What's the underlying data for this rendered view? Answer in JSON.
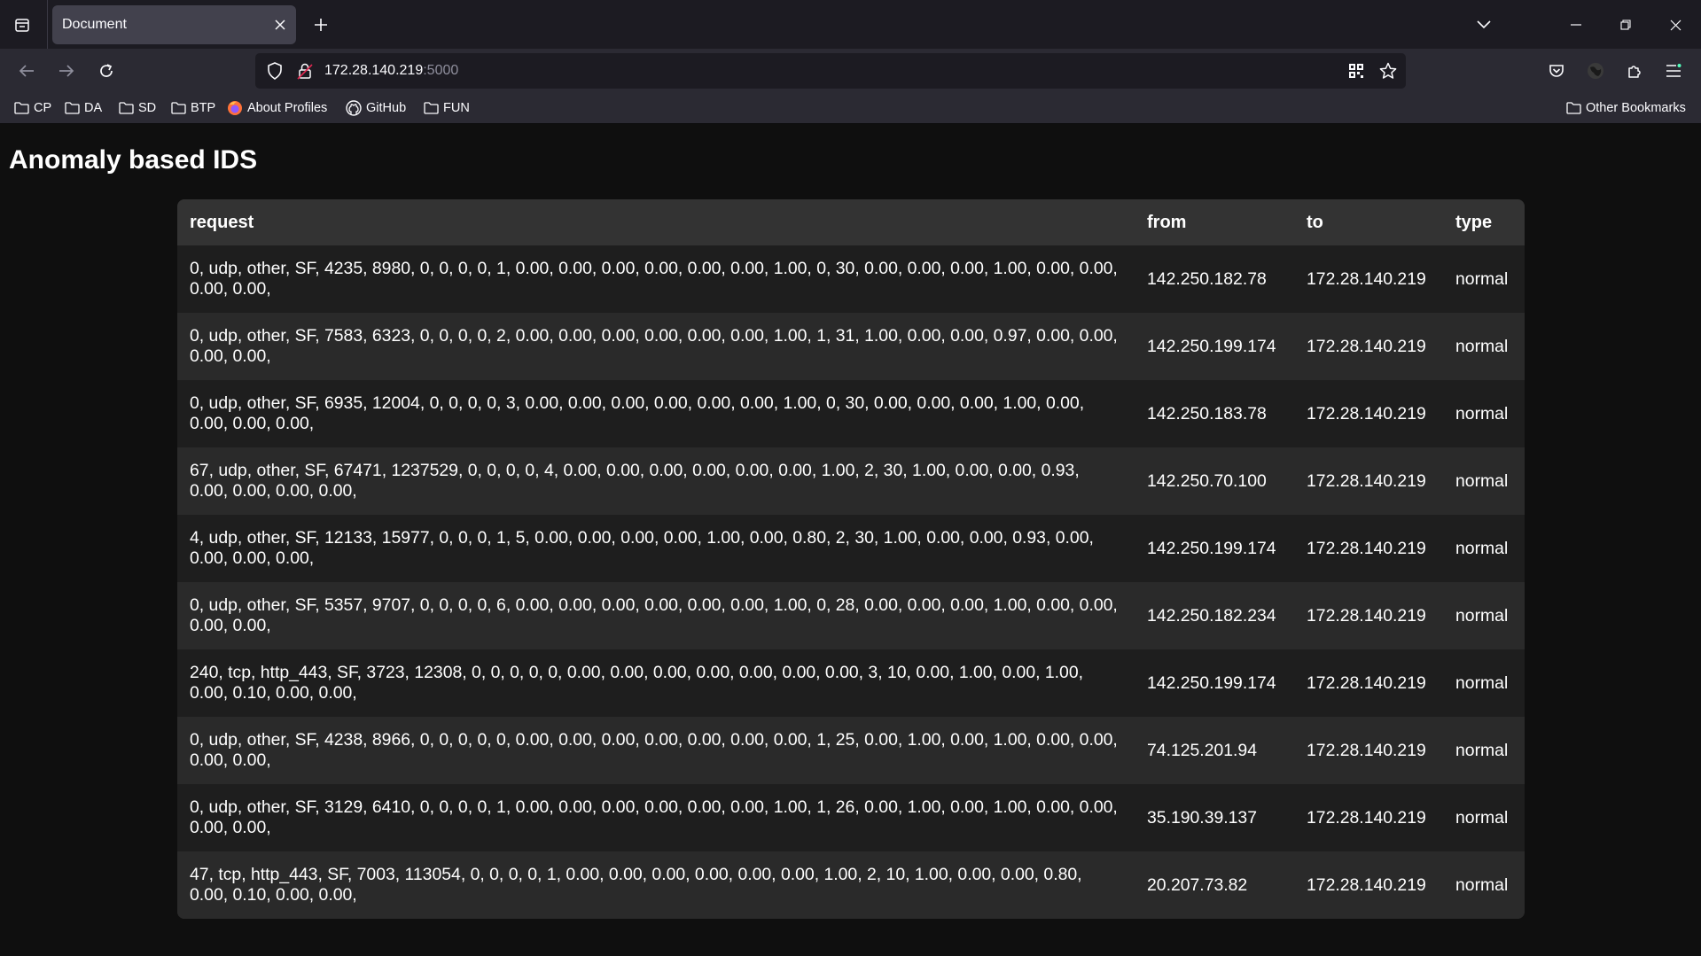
{
  "browser": {
    "tab_title": "Document",
    "url_host": "172.28.140.219",
    "url_port": ":5000",
    "bookmarks": [
      "CP",
      "DA",
      "SD",
      "BTP",
      "About Profiles",
      "GitHub",
      "FUN"
    ],
    "other_bookmarks": "Other Bookmarks"
  },
  "page": {
    "heading": "Anomaly based IDS",
    "columns": [
      "request",
      "from",
      "to",
      "type"
    ],
    "rows": [
      {
        "request": "0, udp, other, SF, 4235, 8980, 0, 0, 0, 0, 1, 0.00, 0.00, 0.00, 0.00, 0.00, 0.00, 1.00, 0, 30, 0.00, 0.00, 0.00, 1.00, 0.00, 0.00, 0.00, 0.00,",
        "from": "142.250.182.78",
        "to": "172.28.140.219",
        "type": "normal"
      },
      {
        "request": "0, udp, other, SF, 7583, 6323, 0, 0, 0, 0, 2, 0.00, 0.00, 0.00, 0.00, 0.00, 0.00, 1.00, 1, 31, 1.00, 0.00, 0.00, 0.97, 0.00, 0.00, 0.00, 0.00,",
        "from": "142.250.199.174",
        "to": "172.28.140.219",
        "type": "normal"
      },
      {
        "request": "0, udp, other, SF, 6935, 12004, 0, 0, 0, 0, 3, 0.00, 0.00, 0.00, 0.00, 0.00, 0.00, 1.00, 0, 30, 0.00, 0.00, 0.00, 1.00, 0.00, 0.00, 0.00, 0.00,",
        "from": "142.250.183.78",
        "to": "172.28.140.219",
        "type": "normal"
      },
      {
        "request": "67, udp, other, SF, 67471, 1237529, 0, 0, 0, 0, 4, 0.00, 0.00, 0.00, 0.00, 0.00, 0.00, 1.00, 2, 30, 1.00, 0.00, 0.00, 0.93, 0.00, 0.00, 0.00, 0.00,",
        "from": "142.250.70.100",
        "to": "172.28.140.219",
        "type": "normal"
      },
      {
        "request": "4, udp, other, SF, 12133, 15977, 0, 0, 0, 1, 5, 0.00, 0.00, 0.00, 0.00, 1.00, 0.00, 0.80, 2, 30, 1.00, 0.00, 0.00, 0.93, 0.00, 0.00, 0.00, 0.00,",
        "from": "142.250.199.174",
        "to": "172.28.140.219",
        "type": "normal"
      },
      {
        "request": "0, udp, other, SF, 5357, 9707, 0, 0, 0, 0, 6, 0.00, 0.00, 0.00, 0.00, 0.00, 0.00, 1.00, 0, 28, 0.00, 0.00, 0.00, 1.00, 0.00, 0.00, 0.00, 0.00,",
        "from": "142.250.182.234",
        "to": "172.28.140.219",
        "type": "normal"
      },
      {
        "request": "240, tcp, http_443, SF, 3723, 12308, 0, 0, 0, 0, 0, 0.00, 0.00, 0.00, 0.00, 0.00, 0.00, 0.00, 3, 10, 0.00, 1.00, 0.00, 1.00, 0.00, 0.10, 0.00, 0.00,",
        "from": "142.250.199.174",
        "to": "172.28.140.219",
        "type": "normal"
      },
      {
        "request": "0, udp, other, SF, 4238, 8966, 0, 0, 0, 0, 0, 0.00, 0.00, 0.00, 0.00, 0.00, 0.00, 0.00, 1, 25, 0.00, 1.00, 0.00, 1.00, 0.00, 0.00, 0.00, 0.00,",
        "from": "74.125.201.94",
        "to": "172.28.140.219",
        "type": "normal"
      },
      {
        "request": "0, udp, other, SF, 3129, 6410, 0, 0, 0, 0, 1, 0.00, 0.00, 0.00, 0.00, 0.00, 0.00, 1.00, 1, 26, 0.00, 1.00, 0.00, 1.00, 0.00, 0.00, 0.00, 0.00,",
        "from": "35.190.39.137",
        "to": "172.28.140.219",
        "type": "normal"
      },
      {
        "request": "47, tcp, http_443, SF, 7003, 113054, 0, 0, 0, 0, 1, 0.00, 0.00, 0.00, 0.00, 0.00, 0.00, 1.00, 2, 10, 1.00, 0.00, 0.00, 0.80, 0.00, 0.10, 0.00, 0.00,",
        "from": "20.207.73.82",
        "to": "172.28.140.219",
        "type": "normal"
      }
    ]
  }
}
